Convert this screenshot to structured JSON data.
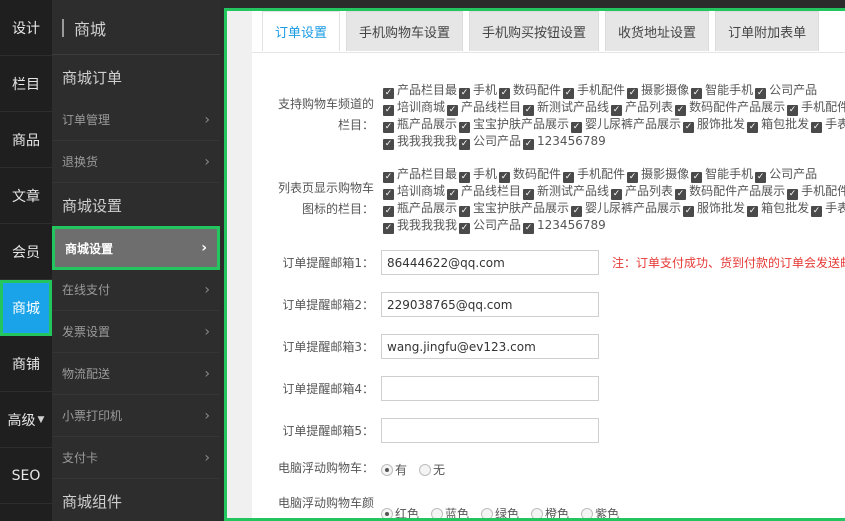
{
  "primary_nav": [
    {
      "label": "设计"
    },
    {
      "label": "栏目"
    },
    {
      "label": "商品"
    },
    {
      "label": "文章"
    },
    {
      "label": "会员"
    },
    {
      "label": "商城"
    },
    {
      "label": "商铺"
    },
    {
      "label": "高级"
    },
    {
      "label": "SEO"
    }
  ],
  "secondary_nav": {
    "title": "商城",
    "group1": "商城订单",
    "group1_items": [
      "订单管理",
      "退换货"
    ],
    "group2": "商城设置",
    "group2_items": [
      "商城设置",
      "在线支付",
      "发票设置",
      "物流配送",
      "小票打印机",
      "支付卡"
    ],
    "group3": "商城组件"
  },
  "tabs": [
    "订单设置",
    "手机购物车设置",
    "手机购买按钮设置",
    "收货地址设置",
    "订单附加表单"
  ],
  "cart_channels": {
    "label_line1": "支持购物车频道的",
    "label_line2": "栏目：",
    "items": [
      "产品栏目最",
      "手机",
      "数码配件",
      "手机配件",
      "摄影摄像",
      "智能手机",
      "公司产品",
      "培训商城",
      "产品线栏目",
      "新测试产品线",
      "产品列表",
      "数码配件产品展示",
      "手机配件",
      "瓶产品展示",
      "宝宝护肤产品展示",
      "婴儿尿裤产品展示",
      "服饰批发",
      "箱包批发",
      "手表",
      "我我我我我",
      "公司产品",
      "123456789"
    ]
  },
  "list_icon": {
    "label_line1": "列表页显示购物车",
    "label_line2": "图标的栏目：",
    "items": [
      "产品栏目最",
      "手机",
      "数码配件",
      "手机配件",
      "摄影摄像",
      "智能手机",
      "公司产品",
      "培训商城",
      "产品线栏目",
      "新测试产品线",
      "产品列表",
      "数码配件产品展示",
      "手机配件",
      "瓶产品展示",
      "宝宝护肤产品展示",
      "婴儿尿裤产品展示",
      "服饰批发",
      "箱包批发",
      "手表",
      "我我我我我",
      "公司产品",
      "123456789"
    ]
  },
  "emails": [
    {
      "label": "订单提醒邮箱1：",
      "value": "86444622@qq.com"
    },
    {
      "label": "订单提醒邮箱2：",
      "value": "229038765@qq.com"
    },
    {
      "label": "订单提醒邮箱3：",
      "value": "wang.jingfu@ev123.com"
    },
    {
      "label": "订单提醒邮箱4：",
      "value": ""
    },
    {
      "label": "订单提醒邮箱5：",
      "value": ""
    }
  ],
  "email_note": "注：订单支付成功、货到付款的订单会发送邮件",
  "float_cart": {
    "label": "电脑浮动购物车：",
    "options": [
      "有",
      "无"
    ],
    "selected": "有"
  },
  "float_color": {
    "label": "电脑浮动购物车颜",
    "options": [
      "红色",
      "蓝色",
      "绿色",
      "橙色",
      "紫色"
    ],
    "selected": "红色"
  },
  "colors": {
    "accent": "#1a9be6",
    "highlight": "#22c55e",
    "active_nav": "#1aa3e8",
    "note": "#e53935"
  }
}
